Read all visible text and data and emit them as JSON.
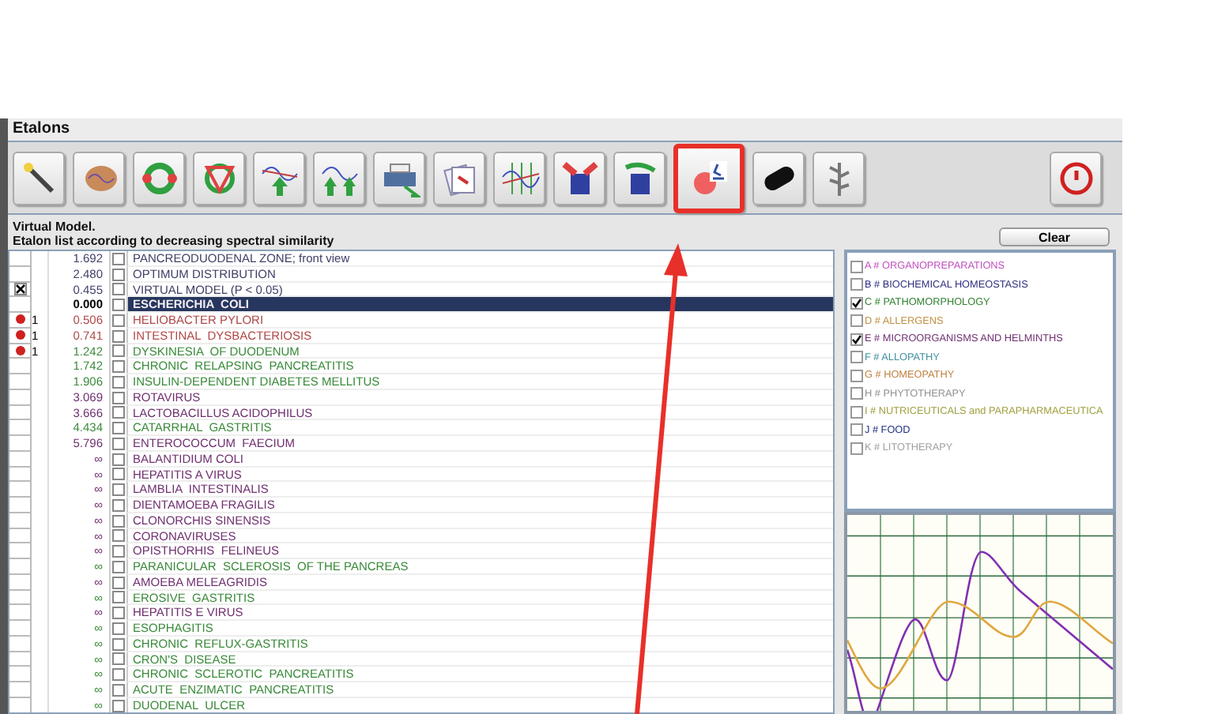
{
  "window": {
    "title": "Etalons"
  },
  "toolbar": [
    {
      "kind": "wand",
      "highlighted": false
    },
    {
      "kind": "brain",
      "highlighted": false
    },
    {
      "kind": "ring",
      "highlighted": false
    },
    {
      "kind": "triangle",
      "highlighted": false
    },
    {
      "kind": "wave-up",
      "highlighted": false
    },
    {
      "kind": "wave-double",
      "highlighted": false
    },
    {
      "kind": "printer",
      "highlighted": false
    },
    {
      "kind": "cards",
      "highlighted": false
    },
    {
      "kind": "wave-grid",
      "highlighted": false
    },
    {
      "kind": "cup-red",
      "highlighted": false
    },
    {
      "kind": "cup-green",
      "highlighted": false
    },
    {
      "kind": "microscope",
      "highlighted": true
    },
    {
      "kind": "capsule",
      "highlighted": false
    },
    {
      "kind": "plant",
      "highlighted": false
    }
  ],
  "info": {
    "line_1": "Virtual Model.",
    "line_2": "Etalon list according to decreasing spectral similarity"
  },
  "clear_button": "Clear",
  "etalons": [
    {
      "checked": false,
      "dot": false,
      "ticked": false,
      "selected": false,
      "value": "1.692",
      "name": "PANCREODUODENAL ZONE; front view",
      "color": "#404068"
    },
    {
      "checked": false,
      "dot": false,
      "ticked": false,
      "selected": false,
      "value": "2.480",
      "name": "OPTIMUM DISTRIBUTION",
      "color": "#404068"
    },
    {
      "checked": true,
      "dot": false,
      "ticked": false,
      "selected": false,
      "value": "0.455",
      "name": "VIRTUAL MODEL (P < 0.05)",
      "color": "#404068"
    },
    {
      "checked": false,
      "dot": false,
      "ticked": false,
      "selected": true,
      "value": "0.000",
      "name": "ESCHERICHIA  COLI"
    },
    {
      "checked": false,
      "dot": true,
      "count": "1",
      "ticked": false,
      "selected": false,
      "value": "0.506",
      "name": "HELIOBACTER PYLORI",
      "color": "#b04848"
    },
    {
      "checked": false,
      "dot": true,
      "count": "1",
      "ticked": false,
      "selected": false,
      "value": "0.741",
      "name": "INTESTINAL  DYSBACTERIOSIS",
      "color": "#b04848"
    },
    {
      "checked": false,
      "dot": true,
      "count": "1",
      "ticked": false,
      "selected": false,
      "value": "1.242",
      "name": "DYSKINESIA  OF DUODENUM",
      "color": "#3a8a3a"
    },
    {
      "checked": false,
      "dot": false,
      "ticked": false,
      "selected": false,
      "value": "1.742",
      "name": "CHRONIC  RELAPSING  PANCREATITIS",
      "color": "#3a8a3a"
    },
    {
      "checked": false,
      "dot": false,
      "ticked": false,
      "selected": false,
      "value": "1.906",
      "name": "INSULIN-DEPENDENT DIABETES MELLITUS",
      "color": "#3a8a3a"
    },
    {
      "checked": false,
      "dot": false,
      "ticked": false,
      "selected": false,
      "value": "3.069",
      "name": "ROTAVIRUS",
      "color": "#703070"
    },
    {
      "checked": false,
      "dot": false,
      "ticked": false,
      "selected": false,
      "value": "3.666",
      "name": "LACTOBACILLUS ACIDOPHILUS",
      "color": "#703070"
    },
    {
      "checked": false,
      "dot": false,
      "ticked": false,
      "selected": false,
      "value": "4.434",
      "name": "CATARRHAL  GASTRITIS",
      "color": "#3a8a3a"
    },
    {
      "checked": false,
      "dot": false,
      "ticked": false,
      "selected": false,
      "value": "5.796",
      "name": "ENTEROCOCCUM  FAECIUM",
      "color": "#703070"
    },
    {
      "checked": false,
      "dot": false,
      "ticked": false,
      "selected": false,
      "value": "∞",
      "name": "BALANTIDIUM COLI",
      "color": "#703070"
    },
    {
      "checked": false,
      "dot": false,
      "ticked": false,
      "selected": false,
      "value": "∞",
      "name": "HEPATITIS A VIRUS",
      "color": "#703070"
    },
    {
      "checked": false,
      "dot": false,
      "ticked": false,
      "selected": false,
      "value": "∞",
      "name": "LAMBLIA  INTESTINALIS",
      "color": "#703070"
    },
    {
      "checked": false,
      "dot": false,
      "ticked": false,
      "selected": false,
      "value": "∞",
      "name": "DIENTAMOEBA FRAGILIS",
      "color": "#703070"
    },
    {
      "checked": false,
      "dot": false,
      "ticked": false,
      "selected": false,
      "value": "∞",
      "name": "CLONORCHIS SINENSIS",
      "color": "#703070"
    },
    {
      "checked": false,
      "dot": false,
      "ticked": false,
      "selected": false,
      "value": "∞",
      "name": "CORONAVIRUSES",
      "color": "#703070"
    },
    {
      "checked": false,
      "dot": false,
      "ticked": false,
      "selected": false,
      "value": "∞",
      "name": "OPISTHORHIS  FELINEUS",
      "color": "#703070"
    },
    {
      "checked": false,
      "dot": false,
      "ticked": false,
      "selected": false,
      "value": "∞",
      "name": "PARANICULAR  SCLEROSIS  OF THE PANCREAS",
      "color": "#3a8a3a"
    },
    {
      "checked": false,
      "dot": false,
      "ticked": false,
      "selected": false,
      "value": "∞",
      "name": "AMOEBA MELEAGRIDIS",
      "color": "#703070"
    },
    {
      "checked": false,
      "dot": false,
      "ticked": false,
      "selected": false,
      "value": "∞",
      "name": "EROSIVE  GASTRITIS",
      "color": "#3a8a3a"
    },
    {
      "checked": false,
      "dot": false,
      "ticked": false,
      "selected": false,
      "value": "∞",
      "name": "HEPATITIS E VIRUS",
      "color": "#703070"
    },
    {
      "checked": false,
      "dot": false,
      "ticked": false,
      "selected": false,
      "value": "∞",
      "name": "ESOPHAGITIS",
      "color": "#3a8a3a"
    },
    {
      "checked": false,
      "dot": false,
      "ticked": false,
      "selected": false,
      "value": "∞",
      "name": "CHRONIC  REFLUX-GASTRITIS",
      "color": "#3a8a3a"
    },
    {
      "checked": false,
      "dot": false,
      "ticked": false,
      "selected": false,
      "value": "∞",
      "name": "CRON'S  DISEASE",
      "color": "#3a8a3a"
    },
    {
      "checked": false,
      "dot": false,
      "ticked": false,
      "selected": false,
      "value": "∞",
      "name": "CHRONIC  SCLEROTIC  PANCREATITIS",
      "color": "#3a8a3a"
    },
    {
      "checked": false,
      "dot": false,
      "ticked": false,
      "selected": false,
      "value": "∞",
      "name": "ACUTE  ENZIMATIC  PANCREATITIS",
      "color": "#3a8a3a"
    },
    {
      "checked": false,
      "dot": false,
      "ticked": false,
      "selected": false,
      "value": "∞",
      "name": "DUODENAL  ULCER",
      "color": "#3a8a3a"
    }
  ],
  "categories": [
    {
      "label": "A # ORGANOPREPARATIONS",
      "checked": false,
      "color": "#c050c0"
    },
    {
      "label": "B # BIOCHEMICAL HOMEOSTASIS",
      "checked": false,
      "color": "#303080"
    },
    {
      "label": "C # PATHOMORPHOLOGY",
      "checked": true,
      "color": "#308030"
    },
    {
      "label": "D # ALLERGENS",
      "checked": false,
      "color": "#c09040"
    },
    {
      "label": "E # MICROORGANISMS AND HELMINTHS",
      "checked": true,
      "color": "#703070"
    },
    {
      "label": "F # ALLOPATHY",
      "checked": false,
      "color": "#4090a0"
    },
    {
      "label": "G # HOMEOPATHY",
      "checked": false,
      "color": "#c08040"
    },
    {
      "label": "H # PHYTOTHERAPY",
      "checked": false,
      "color": "#909090"
    },
    {
      "label": "I # NUTRICEUTICALS and PARAPHARMACEUTICA",
      "checked": false,
      "color": "#a0a040"
    },
    {
      "label": "J # FOOD",
      "checked": false,
      "color": "#203080"
    },
    {
      "label": "K # LITOTHERAPY",
      "checked": false,
      "color": "#a0a0a0"
    }
  ]
}
